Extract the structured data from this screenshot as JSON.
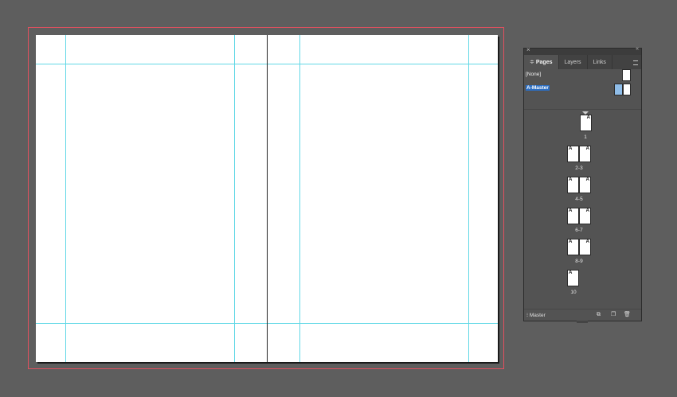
{
  "panel": {
    "close_glyph": "×",
    "collapse_glyph": "«",
    "tabs": [
      {
        "label": "Pages",
        "active": true,
        "prefix": "≑"
      },
      {
        "label": "Layers",
        "active": false
      },
      {
        "label": "Links",
        "active": false
      }
    ],
    "masters": {
      "none_label": "[None]",
      "a_master_label": "A-Master"
    },
    "page_prefix": "A",
    "spreads": [
      {
        "label": "1",
        "pages": 1
      },
      {
        "label": "2-3",
        "pages": 2
      },
      {
        "label": "4-5",
        "pages": 2
      },
      {
        "label": "6-7",
        "pages": 2
      },
      {
        "label": "8-9",
        "pages": 2
      },
      {
        "label": "10",
        "pages": 1
      }
    ],
    "footer": {
      "label": "Master"
    }
  },
  "colors": {
    "background": "#5e5e5e",
    "bleed": "#e2505f",
    "guides": "#62d8e6",
    "panel": "#535353",
    "selection": "#2c6ec2"
  }
}
